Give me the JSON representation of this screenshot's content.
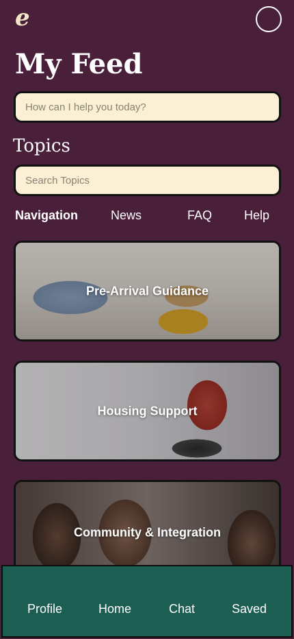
{
  "header": {
    "logo": "e",
    "title": "My Feed"
  },
  "ask": {
    "placeholder": "How can I help you today?"
  },
  "topics": {
    "heading": "Topics",
    "search_placeholder": "Search Topics",
    "tabs": [
      "Navigation",
      "News",
      "FAQ",
      "Help"
    ],
    "active_tab": "Navigation"
  },
  "cards": [
    {
      "label": "Pre-Arrival Guidance"
    },
    {
      "label": "Housing Support"
    },
    {
      "label": "Community & Integration"
    }
  ],
  "bottom_nav": {
    "items": [
      "Profile",
      "Home",
      "Chat",
      "Saved"
    ]
  },
  "colors": {
    "background": "#4a1f3a",
    "input": "#fbf0d4",
    "bottom_nav": "#1d5e52"
  }
}
